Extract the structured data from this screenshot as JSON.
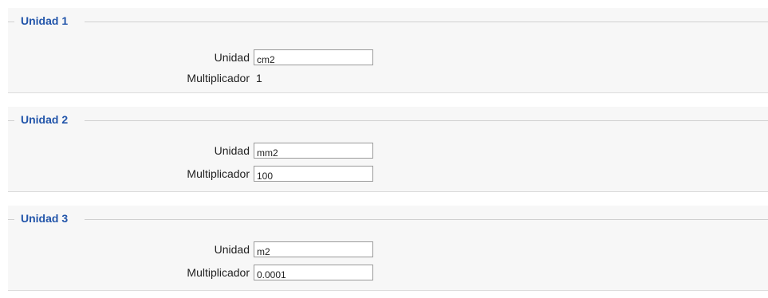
{
  "units": [
    {
      "legend": "Unidad 1",
      "unit_label": "Unidad",
      "unit_value": "cm2",
      "mult_label": "Multiplicador",
      "mult_value": "1",
      "mult_editable": false
    },
    {
      "legend": "Unidad 2",
      "unit_label": "Unidad",
      "unit_value": "mm2",
      "mult_label": "Multiplicador",
      "mult_value": "100",
      "mult_editable": true
    },
    {
      "legend": "Unidad 3",
      "unit_label": "Unidad",
      "unit_value": "m2",
      "mult_label": "Multiplicador",
      "mult_value": "0.0001",
      "mult_editable": true
    }
  ],
  "colors": {
    "legend": "#2255aa",
    "section_bg": "#f7f7f7"
  }
}
